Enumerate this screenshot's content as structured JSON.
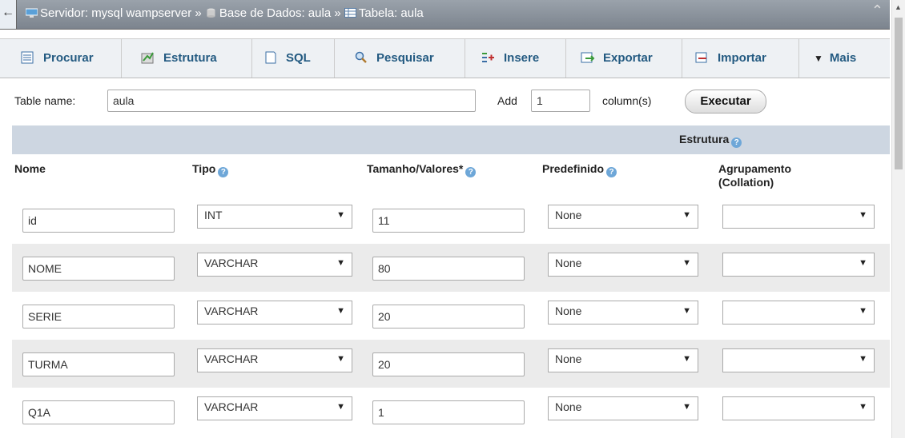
{
  "breadcrumb": {
    "server": "Servidor: mysql wampserver",
    "sep1": "»",
    "database": "Base de Dados: aula",
    "sep2": "»",
    "table": "Tabela: aula"
  },
  "tabs": [
    {
      "label": "Procurar",
      "icon": "browse-icon"
    },
    {
      "label": "Estrutura",
      "icon": "structure-icon"
    },
    {
      "label": "SQL",
      "icon": "sql-icon"
    },
    {
      "label": "Pesquisar",
      "icon": "search-icon"
    },
    {
      "label": "Insere",
      "icon": "insert-icon"
    },
    {
      "label": "Exportar",
      "icon": "export-icon"
    },
    {
      "label": "Importar",
      "icon": "import-icon"
    },
    {
      "label": "Mais",
      "icon": "caret-down-icon"
    }
  ],
  "form": {
    "table_name_label": "Table name:",
    "table_name_value": "aula",
    "add_label": "Add",
    "add_value": "1",
    "columns_label": "column(s)",
    "execute_label": "Executar"
  },
  "structure": {
    "title": "Estrutura",
    "headers": {
      "name": "Nome",
      "type": "Tipo",
      "length": "Tamanho/Valores*",
      "default": "Predefinido",
      "collation_line1": "Agrupamento",
      "collation_line2": "(Collation)"
    },
    "rows": [
      {
        "name": "id",
        "type": "INT",
        "length": "11",
        "default": "None",
        "collation": ""
      },
      {
        "name": "NOME",
        "type": "VARCHAR",
        "length": "80",
        "default": "None",
        "collation": ""
      },
      {
        "name": "SERIE",
        "type": "VARCHAR",
        "length": "20",
        "default": "None",
        "collation": ""
      },
      {
        "name": "TURMA",
        "type": "VARCHAR",
        "length": "20",
        "default": "None",
        "collation": ""
      },
      {
        "name": "Q1A",
        "type": "VARCHAR",
        "length": "1",
        "default": "None",
        "collation": ""
      }
    ]
  },
  "colors": {
    "tab_text": "#235a81",
    "topbar": "#8a929b",
    "structure_bar": "#cdd6e1",
    "row_alt": "#ebebeb"
  }
}
